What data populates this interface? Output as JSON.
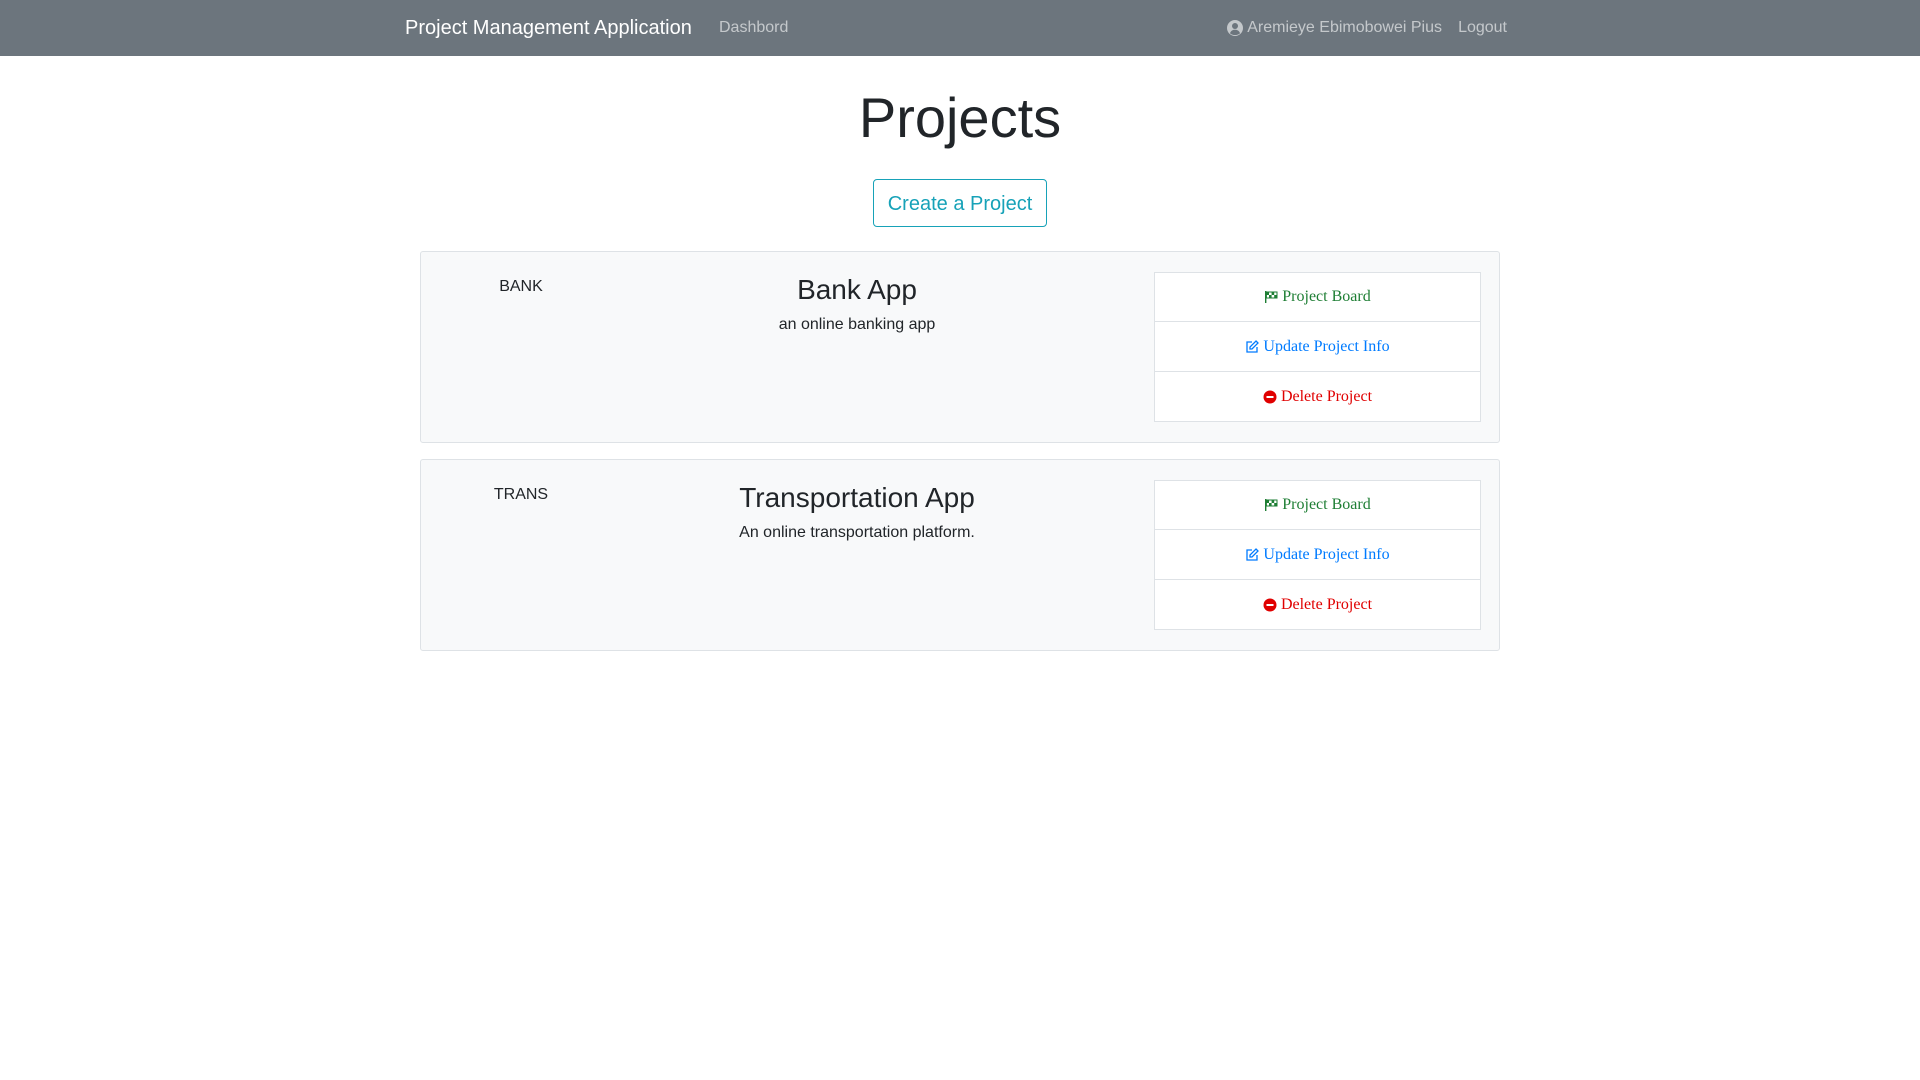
{
  "navbar": {
    "brand": "Project Management Application",
    "dashboard": "Dashbord",
    "user": "Aremieye Ebimobowei Pius",
    "logout": "Logout"
  },
  "page": {
    "title": "Projects",
    "create_button": "Create a Project"
  },
  "projects": [
    {
      "identifier": "BANK",
      "name": "Bank App",
      "description": "an online banking app",
      "actions": {
        "board": "Project Board",
        "update": "Update Project Info",
        "delete": "Delete Project"
      }
    },
    {
      "identifier": "TRANS",
      "name": "Transportation App",
      "description": "An online transportation platform.",
      "actions": {
        "board": "Project Board",
        "update": "Update Project Info",
        "delete": "Delete Project"
      }
    }
  ],
  "icons": {
    "user": "user-circle-icon",
    "board": "flag-checkered-icon",
    "update": "edit-icon",
    "delete": "minus-circle-icon"
  },
  "colors": {
    "navbar": "#6c757d",
    "accent": "#17a2b8",
    "board": "#1e7e34",
    "update": "#007bff",
    "delete": "#e00000"
  }
}
